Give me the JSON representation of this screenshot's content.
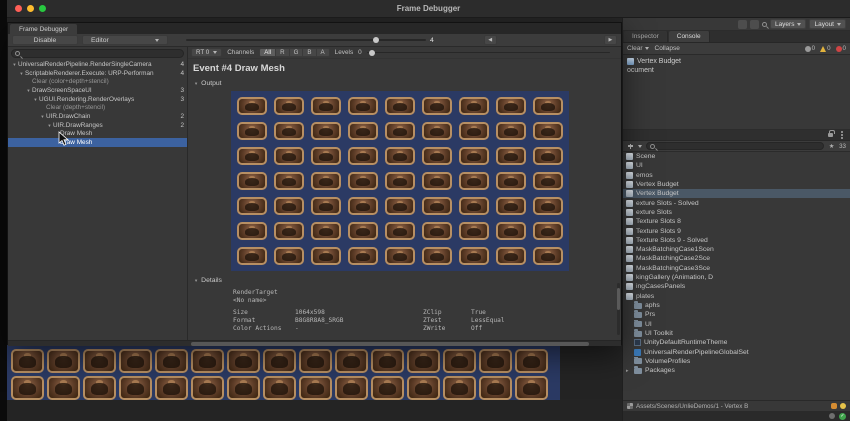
{
  "titlebar": {
    "title": "Frame Debugger"
  },
  "colors": {
    "selection_blue": "#3c62a0",
    "output_background": "#2b3a64",
    "tile_border_tan": "#b78f63",
    "panel_gray": "#383838"
  },
  "frame_debugger": {
    "tab_label": "Frame Debugger",
    "toolbar": {
      "disable_label": "Disable",
      "editor_label": "Editor",
      "frame_value": "4",
      "prev_label": "◀",
      "next_label": "▶"
    },
    "tree": [
      {
        "label": "UniversalRenderPipeline.RenderSingleCamera",
        "count": "4",
        "depth": 0,
        "expanded": true
      },
      {
        "label": "ScriptableRenderer.Execute: URP-Performan",
        "count": "4",
        "depth": 1,
        "expanded": true
      },
      {
        "label": "Clear (color+depth+stencil)",
        "count": "",
        "depth": 2,
        "dim": true
      },
      {
        "label": "DrawScreenSpaceUI",
        "count": "3",
        "depth": 2,
        "expanded": true
      },
      {
        "label": "UGUI.Rendering.RenderOverlays",
        "count": "3",
        "depth": 3,
        "expanded": true
      },
      {
        "label": "Clear (depth+stencil)",
        "count": "",
        "depth": 4,
        "dim": true
      },
      {
        "label": "UIR.DrawChain",
        "count": "2",
        "depth": 4,
        "expanded": true
      },
      {
        "label": "UIR.DrawRanges",
        "count": "2",
        "depth": 5,
        "expanded": true
      },
      {
        "label": "Draw Mesh",
        "count": "",
        "depth": 6
      },
      {
        "label": "Draw Mesh",
        "count": "",
        "depth": 6,
        "selected": true
      }
    ],
    "preview_toolbar": {
      "rt_label": "RT 0",
      "channels_label": "Channels",
      "channel_buttons": [
        "All",
        "R",
        "G",
        "B",
        "A"
      ],
      "levels_label": "Levels",
      "levels_value": "0"
    },
    "event_title": "Event #4 Draw Mesh",
    "output_label": "Output",
    "details_label": "Details",
    "details": {
      "render_target_label": "RenderTarget",
      "target_name": "<No name>",
      "rows": [
        {
          "label1": "Size",
          "value1": "1064x598",
          "label2": "ZClip",
          "value2": "True"
        },
        {
          "label1": "Format",
          "value1": "B8G8R8A8_SRGB",
          "label2": "ZTest",
          "value2": "LessEqual"
        },
        {
          "label1": "Color Actions",
          "value1": "-",
          "label2": "ZWrite",
          "value2": "Off"
        }
      ]
    },
    "output_grid": {
      "cols": 9,
      "rows": 7
    }
  },
  "editor": {
    "toolbar": {
      "layers_label": "Layers",
      "layout_label": "Layout"
    },
    "tabs": [
      {
        "label": "Inspector"
      },
      {
        "label": "Console"
      }
    ],
    "console": {
      "clear_label": "Clear",
      "collapse_label": "Collapse",
      "info_count": "0",
      "warning_count": "0",
      "error_count": "0",
      "log_title": "Vertex Budget",
      "log_line2": "ocument"
    },
    "project": {
      "badge": "33",
      "assets": [
        {
          "label": "Scene"
        },
        {
          "label": "UI"
        },
        {
          "label": "emos"
        },
        {
          "label": "Vertex Budget"
        },
        {
          "label": "Vertex Budget",
          "selected": true
        },
        {
          "label": "exture Slots - Solved"
        },
        {
          "label": "exture Slots"
        },
        {
          "label": "Texture Slots 8"
        },
        {
          "label": "Texture Slots 9"
        },
        {
          "label": "Texture Slots 9 - Solved"
        },
        {
          "label": "MaskBatchingCase1Scen"
        },
        {
          "label": "MaskBatchingCase2Sce"
        },
        {
          "label": "MaskBatchingCase3Sce"
        },
        {
          "label": "kingGallery (Animation, D"
        },
        {
          "label": "ingCasesPanels"
        },
        {
          "label": "plates"
        }
      ],
      "folders": [
        {
          "label": "aphs",
          "icon": "folder"
        },
        {
          "label": "Prs",
          "icon": "folder"
        },
        {
          "label": "UI",
          "icon": "folder"
        },
        {
          "label": "UI Toolkit",
          "icon": "folder"
        },
        {
          "label": "UnityDefaultRuntimeTheme",
          "icon": "theme"
        },
        {
          "label": "UniversalRenderPipelineGlobalSet",
          "icon": "asset"
        },
        {
          "label": "VolumeProfiles",
          "icon": "folder"
        },
        {
          "label": "Packages",
          "icon": "folder",
          "arrow": true
        }
      ]
    },
    "status_bar": {
      "path": "Assets/Scenes/UnlieDemos/1 - Vertex B"
    }
  },
  "game_strip": {
    "cols": 15,
    "rows": 2
  }
}
